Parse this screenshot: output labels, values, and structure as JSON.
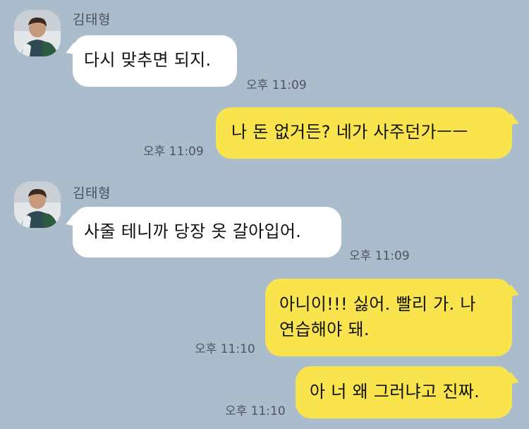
{
  "messages": [
    {
      "sender": "김태형",
      "text": "다시 맞추면 되지.",
      "time": "오후 11:09"
    },
    {
      "text": "나 돈 없거든? 네가 사주던가ㅡㅡ",
      "time": "오후 11:09"
    },
    {
      "sender": "김태형",
      "text": "사줄 테니까 당장 옷 갈아입어.",
      "time": "오후 11:09"
    },
    {
      "text_line1": "아니이!!! 싫어. 빨리 가. 나",
      "text_line2": "연습해야 돼.",
      "time": "오후 11:10"
    },
    {
      "text": "아 너 왜 그러냐고 진짜.",
      "time": "오후 11:10"
    }
  ],
  "icons": {
    "avatar": "profile-photo-avatar"
  },
  "colors": {
    "background": "#abbdcd",
    "incoming_bubble": "#ffffff",
    "outgoing_bubble": "#f9e44e"
  }
}
